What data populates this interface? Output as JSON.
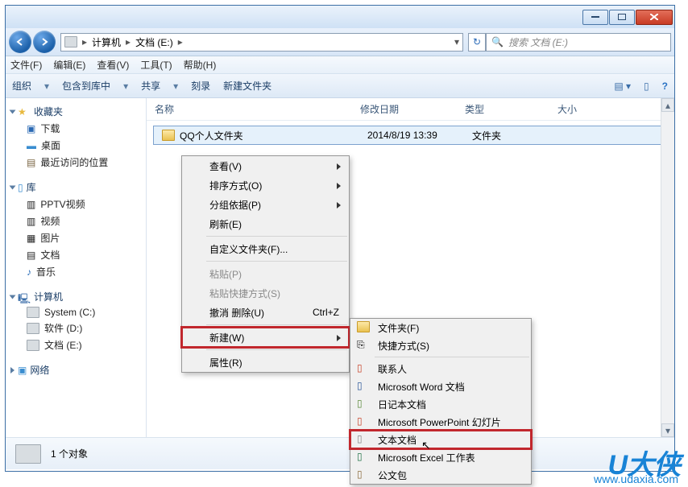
{
  "window": {
    "breadcrumb": {
      "computer": "计算机",
      "drive": "文档 (E:)"
    },
    "search_placeholder": "搜索 文档 (E:)"
  },
  "menubar": {
    "file": "文件(F)",
    "edit": "编辑(E)",
    "view": "查看(V)",
    "tools": "工具(T)",
    "help": "帮助(H)"
  },
  "toolbar": {
    "organize": "组织",
    "include": "包含到库中",
    "share": "共享",
    "burn": "刻录",
    "newfolder": "新建文件夹"
  },
  "sidebar": {
    "favorites": {
      "head": "收藏夹",
      "items": [
        "下载",
        "桌面",
        "最近访问的位置"
      ]
    },
    "libraries": {
      "head": "库",
      "items": [
        "PPTV视频",
        "视频",
        "图片",
        "文档",
        "音乐"
      ]
    },
    "computer": {
      "head": "计算机",
      "items": [
        "System (C:)",
        "软件 (D:)",
        "文档 (E:)"
      ]
    },
    "network": {
      "head": "网络"
    }
  },
  "columns": {
    "name": "名称",
    "date": "修改日期",
    "type": "类型",
    "size": "大小"
  },
  "files": [
    {
      "name": "QQ个人文件夹",
      "date": "2014/8/19 13:39",
      "type": "文件夹",
      "size": ""
    }
  ],
  "status": {
    "count": "1 个对象"
  },
  "context": {
    "view": "查看(V)",
    "sort": "排序方式(O)",
    "group": "分组依据(P)",
    "refresh": "刷新(E)",
    "customize": "自定义文件夹(F)...",
    "paste": "粘贴(P)",
    "paste_shortcut": "粘贴快捷方式(S)",
    "undo": "撤消 删除(U)",
    "undo_sc": "Ctrl+Z",
    "new": "新建(W)",
    "properties": "属性(R)"
  },
  "submenu": {
    "folder": "文件夹(F)",
    "shortcut": "快捷方式(S)",
    "contact": "联系人",
    "word": "Microsoft Word 文档",
    "journal": "日记本文档",
    "ppt": "Microsoft PowerPoint 幻灯片",
    "txt": "文本文档",
    "excel": "Microsoft Excel 工作表",
    "briefcase": "公文包"
  },
  "watermark": {
    "logo": "U大侠",
    "url": "www.udaxia.com"
  }
}
